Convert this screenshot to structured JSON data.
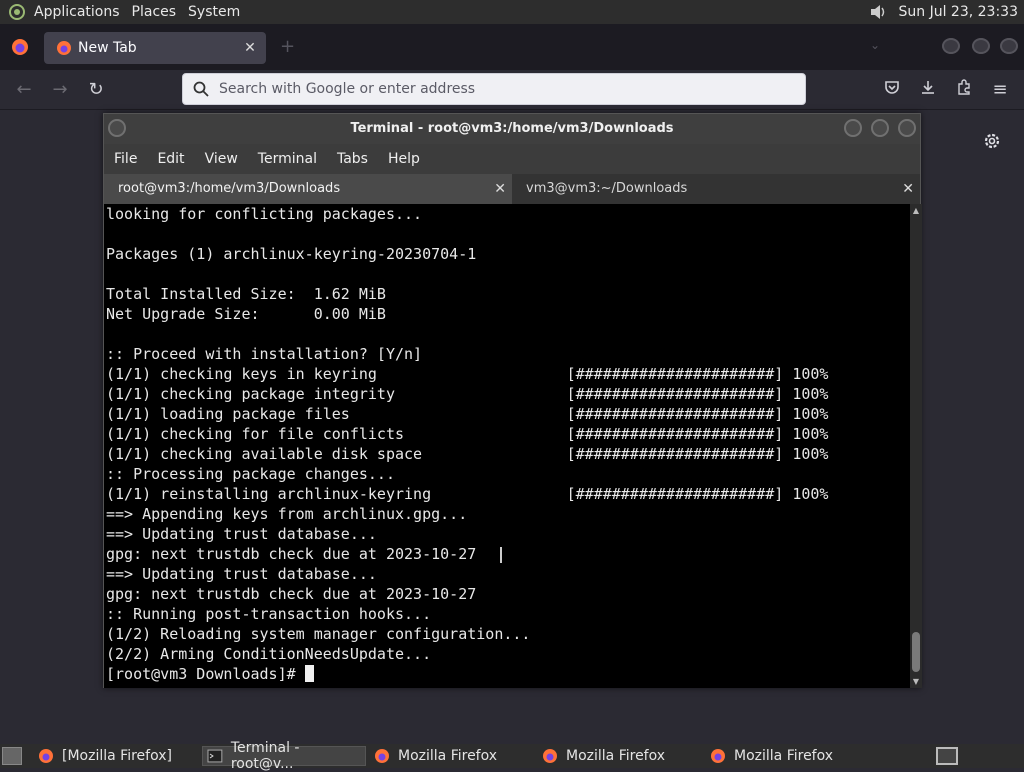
{
  "top_panel": {
    "menus": [
      "Applications",
      "Places",
      "System"
    ],
    "clock": "Sun Jul 23, 23:33"
  },
  "firefox": {
    "tab_title": "New Tab",
    "url_placeholder": "Search with Google or enter address"
  },
  "terminal": {
    "title": "Terminal - root@vm3:/home/vm3/Downloads",
    "menu": [
      "File",
      "Edit",
      "View",
      "Terminal",
      "Tabs",
      "Help"
    ],
    "tabs": [
      {
        "label": "root@vm3:/home/vm3/Downloads"
      },
      {
        "label": "vm3@vm3:~/Downloads"
      }
    ],
    "lines": [
      "looking for conflicting packages...",
      "",
      "Packages (1) archlinux-keyring-20230704-1",
      "",
      "Total Installed Size:  1.62 MiB",
      "Net Upgrade Size:      0.00 MiB",
      "",
      ":: Proceed with installation? [Y/n]",
      "(1/1) checking keys in keyring                     [######################] 100%",
      "(1/1) checking package integrity                   [######################] 100%",
      "(1/1) loading package files                        [######################] 100%",
      "(1/1) checking for file conflicts                  [######################] 100%",
      "(1/1) checking available disk space                [######################] 100%",
      ":: Processing package changes...",
      "(1/1) reinstalling archlinux-keyring               [######################] 100%",
      "==> Appending keys from archlinux.gpg...",
      "==> Updating trust database...",
      "gpg: next trustdb check due at 2023-10-27",
      "==> Updating trust database...",
      "gpg: next trustdb check due at 2023-10-27",
      ":: Running post-transaction hooks...",
      "(1/2) Reloading system manager configuration...",
      "(2/2) Arming ConditionNeedsUpdate...",
      "[root@vm3 Downloads]# "
    ]
  },
  "taskbar": {
    "items": [
      "[Mozilla Firefox]",
      "Terminal - root@v...",
      "Mozilla Firefox",
      "Mozilla Firefox",
      "Mozilla Firefox"
    ]
  }
}
